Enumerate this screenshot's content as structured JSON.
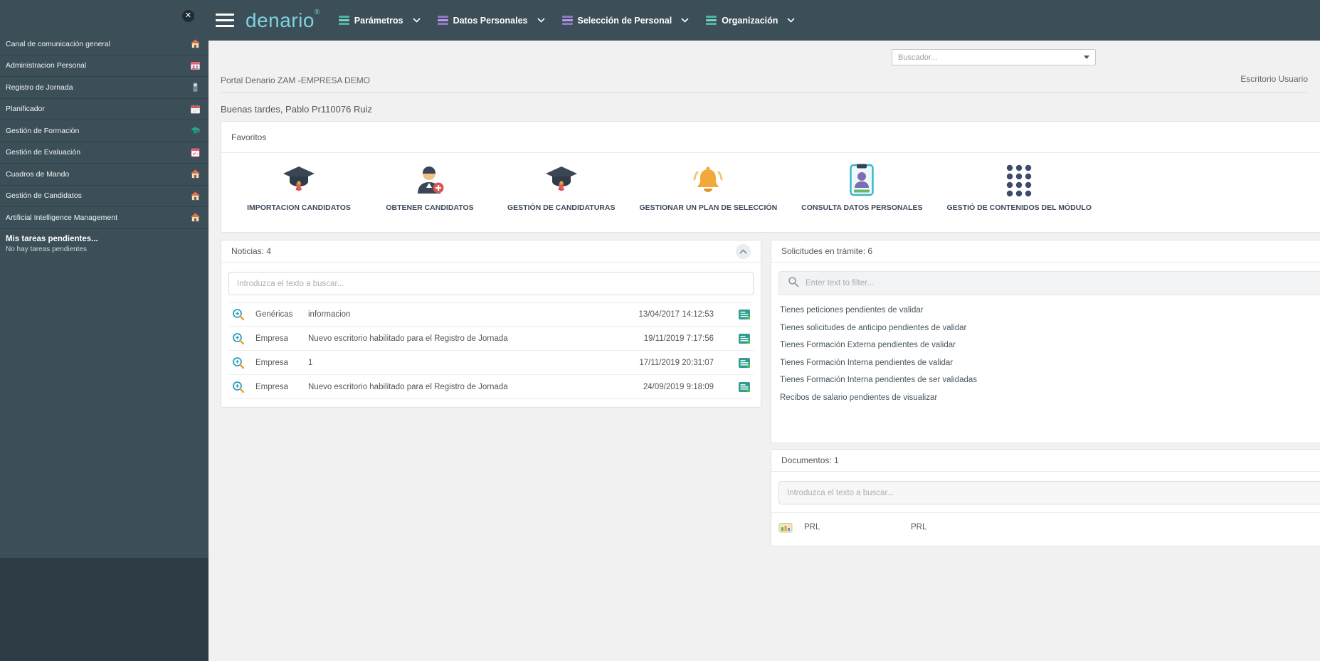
{
  "colors": {
    "sidebar_bg": "#3c4e58",
    "topbar_bg": "#3c4e58",
    "logo": "#7fd2e0",
    "main_bg": "#f1f1f2",
    "accent_red": "#d9534f",
    "accent_teal": "#2f9e8e"
  },
  "sidebar": {
    "items": [
      {
        "label": "Canal de comunicación general",
        "icon": "house-icon"
      },
      {
        "label": "Administracion Personal",
        "icon": "people-card-icon"
      },
      {
        "label": "Registro de Jornada",
        "icon": "time-clock-icon"
      },
      {
        "label": "Planificador",
        "icon": "calendar-icon"
      },
      {
        "label": "Gestión de Formación",
        "icon": "graduation-icon"
      },
      {
        "label": "Gestión de Evaluación",
        "icon": "checklist-icon"
      },
      {
        "label": "Cuadros de Mando",
        "icon": "house-icon"
      },
      {
        "label": "Gestión de Candidatos",
        "icon": "house-icon"
      },
      {
        "label": "Artificial Intelligence Management",
        "icon": "house-icon"
      }
    ],
    "tasks_title": "Mis tareas pendientes...",
    "tasks_empty": "No hay tareas pendientes"
  },
  "topnav": {
    "logo": "denario",
    "logo_sup": "®",
    "menus": [
      {
        "label": "Parámetros"
      },
      {
        "label": "Datos Personales"
      },
      {
        "label": "Selección de Personal"
      },
      {
        "label": "Organización"
      }
    ]
  },
  "header": {
    "search_placeholder": "Buscador...",
    "breadcrumb": "Portal Denario ZAM -EMPRESA DEMO",
    "breadcrumb_right": "Escritorio Usuario",
    "greeting": "Buenas tardes, Pablo Pr110076 Ruiz"
  },
  "favorites": {
    "title": "Favoritos",
    "items": [
      {
        "label": "IMPORTACION CANDIDATOS",
        "icon": "graduation-cap-icon"
      },
      {
        "label": "OBTENER CANDIDATOS",
        "icon": "person-add-icon"
      },
      {
        "label": "GESTIÓN DE CANDIDATURAS",
        "icon": "graduation-cap-icon"
      },
      {
        "label": "GESTIONAR UN PLAN DE SELECCIÓN",
        "icon": "bell-icon"
      },
      {
        "label": "CONSULTA DATOS PERSONALES",
        "icon": "id-card-icon"
      },
      {
        "label": "GESTIÓ DE CONTENIDOS DEL MÓDULO",
        "icon": "grid-dots-icon"
      }
    ]
  },
  "noticias": {
    "title": "Noticias: 4",
    "search_placeholder": "Introduzca el texto a buscar...",
    "rows": [
      {
        "category": "Genéricas",
        "text": "informacion",
        "datetime": "13/04/2017 14:12:53"
      },
      {
        "category": "Empresa",
        "text": "Nuevo escritorio habilitado para el Registro de Jornada",
        "datetime": "19/11/2019 7:17:56"
      },
      {
        "category": "Empresa",
        "text": "1",
        "datetime": "17/11/2019 20:31:07"
      },
      {
        "category": "Empresa",
        "text": "Nuevo escritorio habilitado para el Registro de Jornada",
        "datetime": "24/09/2019 9:18:09"
      }
    ]
  },
  "solicitudes": {
    "title": "Solicitudes en trámite: 6",
    "filter_placeholder": "Enter text to filter...",
    "items": [
      "Tienes peticiones pendientes de validar",
      "Tienes solicitudes de anticipo pendientes de validar",
      "Tienes Formación Externa pendientes de validar",
      "Tienes Formación Interna pendientes de validar",
      "Tienes Formación Interna pendientes de ser validadas",
      "Recibos de salario pendientes de visualizar"
    ]
  },
  "documentos": {
    "title": "Documentos: 1",
    "search_placeholder": "Introduzca el texto a buscar...",
    "rows": [
      {
        "name": "PRL",
        "description": "PRL"
      }
    ]
  }
}
